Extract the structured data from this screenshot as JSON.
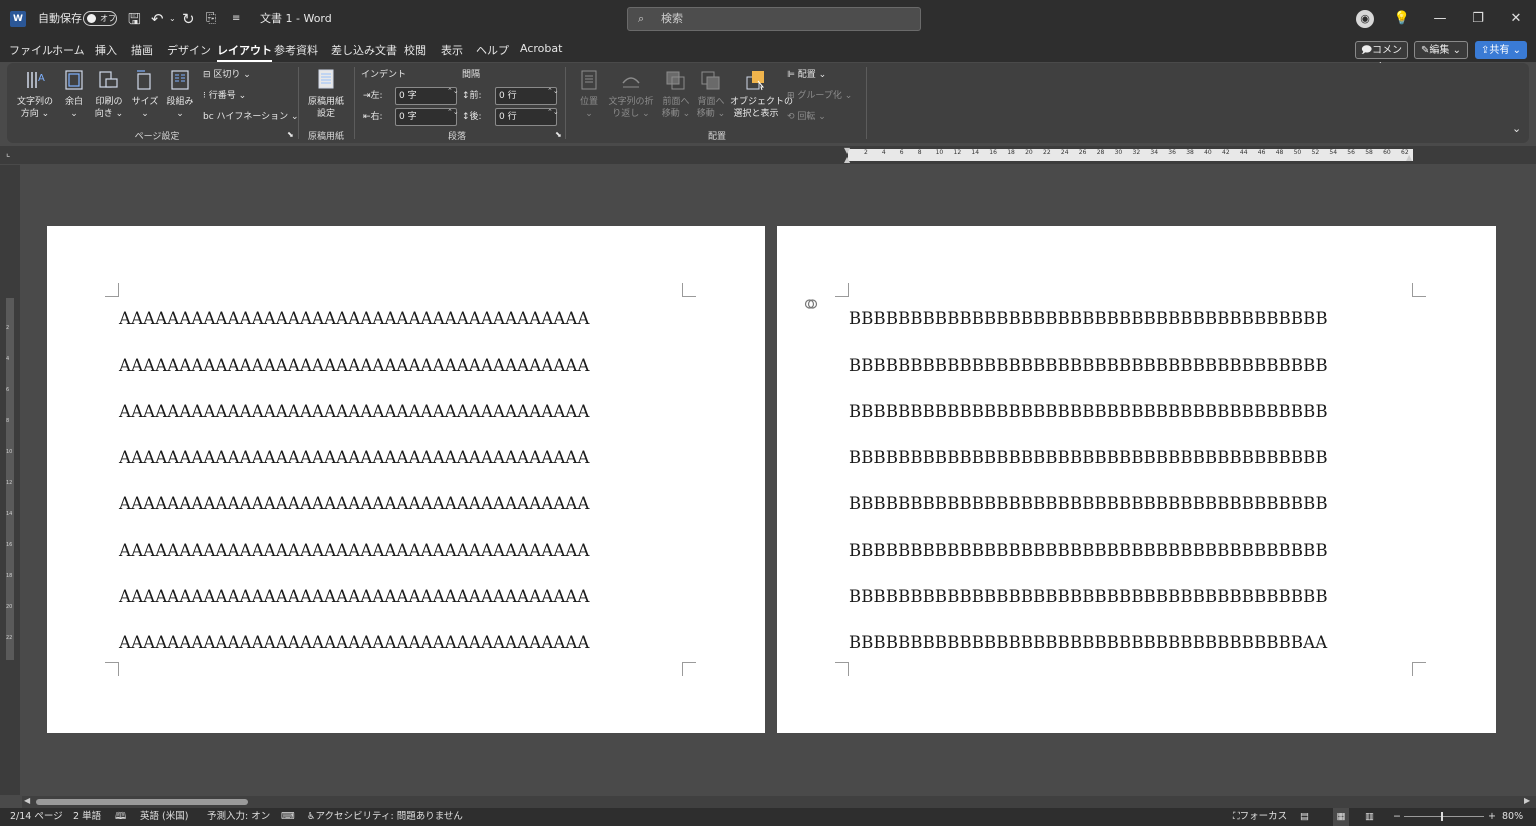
{
  "titlebar": {
    "app_icon": "word-app-icon",
    "autosave_label": "自動保存",
    "autosave_state": "オフ",
    "doc_title": "文書 1  -  Word",
    "search_placeholder": "検索"
  },
  "menu": {
    "tabs": [
      "ファイル",
      "ホーム",
      "挿入",
      "描画",
      "デザイン",
      "レイアウト",
      "参考資料",
      "差し込み文書",
      "校閲",
      "表示",
      "ヘルプ",
      "Acrobat"
    ],
    "active_tab": "レイアウト",
    "comment_label": "コメント",
    "edit_label": "編集",
    "share_label": "共有"
  },
  "ribbon": {
    "page_setup": {
      "text_direction": [
        "文字列の",
        "方向"
      ],
      "margins": "余白",
      "orientation": [
        "印刷の",
        "向き"
      ],
      "size": "サイズ",
      "columns": "段組み",
      "breaks": "区切り",
      "line_numbers": "行番号",
      "hyphenation": "ハイフネーション",
      "group_name": "ページ設定"
    },
    "manuscript": {
      "button": [
        "原稿用紙",
        "設定"
      ],
      "group_name": "原稿用紙"
    },
    "paragraph": {
      "indent_label": "インデント",
      "spacing_label": "間隔",
      "left_label": "左:",
      "left_value": "0 字",
      "right_label": "右:",
      "right_value": "0 字",
      "before_label": "前:",
      "before_value": "0 行",
      "after_label": "後:",
      "after_value": "0 行",
      "group_name": "段落"
    },
    "arrange": {
      "position": "位置",
      "wrap_text": [
        "文字列の折",
        "り返し"
      ],
      "bring_forward": [
        "前面へ",
        "移動"
      ],
      "send_backward": [
        "背面へ",
        "移動"
      ],
      "selection_pane": [
        "オブジェクトの",
        "選択と表示"
      ],
      "align": "配置",
      "group": "グループ化",
      "rotate": "回転",
      "group_name": "配置"
    }
  },
  "ruler": {
    "numbers": [
      "2",
      "4",
      "6",
      "8",
      "10",
      "12",
      "14",
      "16",
      "18",
      "20",
      "22",
      "24",
      "26",
      "28",
      "30",
      "32",
      "34",
      "36",
      "38",
      "40",
      "42",
      "44",
      "46",
      "48",
      "50",
      "52",
      "54",
      "56",
      "58",
      "60",
      "62"
    ],
    "vnumbers": [
      "2",
      "4",
      "6",
      "8",
      "10",
      "12",
      "14",
      "16",
      "18",
      "20",
      "22"
    ]
  },
  "page1": {
    "lines": [
      "AAAAAAAAAAAAAAAAAAAAAAAAAAAAAAAAAAAAAAA",
      "AAAAAAAAAAAAAAAAAAAAAAAAAAAAAAAAAAAAAAA",
      "AAAAAAAAAAAAAAAAAAAAAAAAAAAAAAAAAAAAAAA",
      "AAAAAAAAAAAAAAAAAAAAAAAAAAAAAAAAAAAAAAA",
      "AAAAAAAAAAAAAAAAAAAAAAAAAAAAAAAAAAAAAAA",
      "AAAAAAAAAAAAAAAAAAAAAAAAAAAAAAAAAAAAAAA",
      "AAAAAAAAAAAAAAAAAAAAAAAAAAAAAAAAAAAAAAA",
      "AAAAAAAAAAAAAAAAAAAAAAAAAAAAAAAAAAAAAAA"
    ]
  },
  "page2": {
    "lines": [
      "BBBBBBBBBBBBBBBBBBBBBBBBBBBBBBBBBBBBBBB",
      "BBBBBBBBBBBBBBBBBBBBBBBBBBBBBBBBBBBBBBB",
      "BBBBBBBBBBBBBBBBBBBBBBBBBBBBBBBBBBBBBBB",
      "BBBBBBBBBBBBBBBBBBBBBBBBBBBBBBBBBBBBBBB",
      "BBBBBBBBBBBBBBBBBBBBBBBBBBBBBBBBBBBBBBB",
      "BBBBBBBBBBBBBBBBBBBBBBBBBBBBBBBBBBBBBBB",
      "BBBBBBBBBBBBBBBBBBBBBBBBBBBBBBBBBBBBBBB",
      "BBBBBBBBBBBBBBBBBBBBBBBBBBBBBBBBBBBBBAA"
    ]
  },
  "status": {
    "page": "2/14 ページ",
    "words": "2 単語",
    "language": "英語 (米国)",
    "predictive": "予測入力: オン",
    "accessibility": "アクセシビリティ: 問題ありません",
    "focus": "フォーカス",
    "zoom": "80%"
  }
}
